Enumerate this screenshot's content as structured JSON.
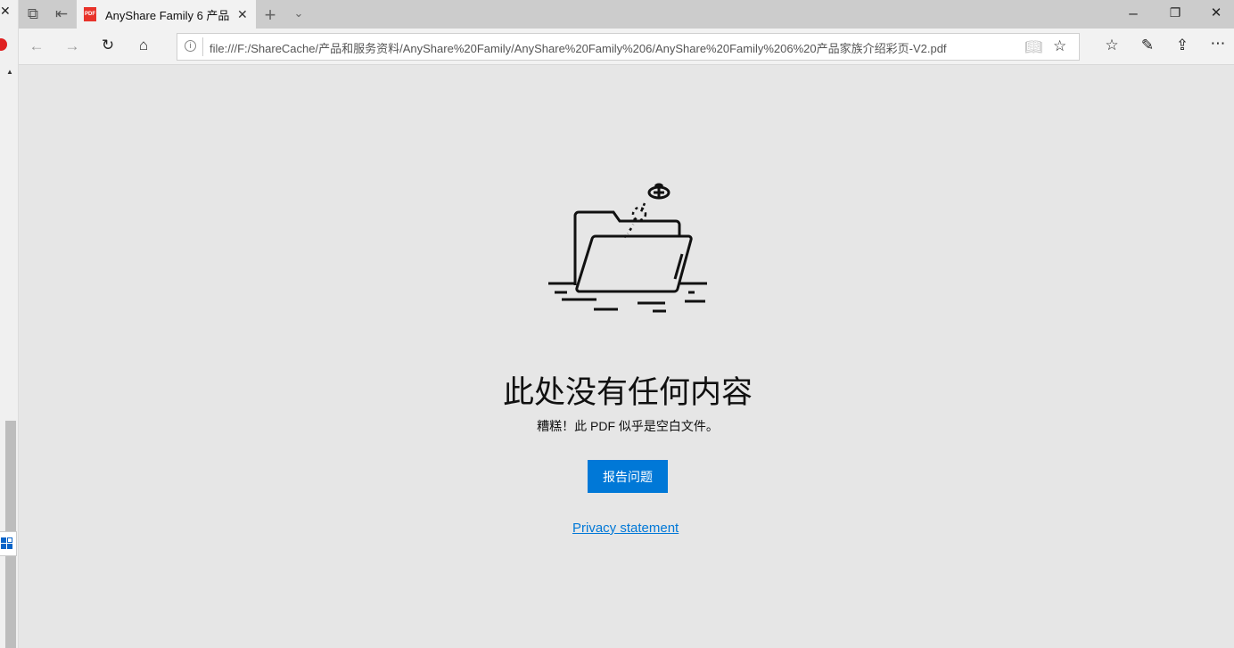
{
  "browser": {
    "tab": {
      "title": "AnyShare Family 6 产品",
      "icon": "pdf-icon"
    },
    "address": "file:///F:/ShareCache/产品和服务资料/AnyShare%20Family/AnyShare%20Family%206/AnyShare%20Family%206%20产品家族介绍彩页-V2.pdf"
  },
  "empty_state": {
    "title": "此处没有任何内容",
    "subtitle": "糟糕！此 PDF 似乎是空白文件。",
    "report_button": "报告问题",
    "privacy_link": "Privacy statement"
  },
  "colors": {
    "accent": "#0078d7",
    "background": "#e6e6e6"
  }
}
